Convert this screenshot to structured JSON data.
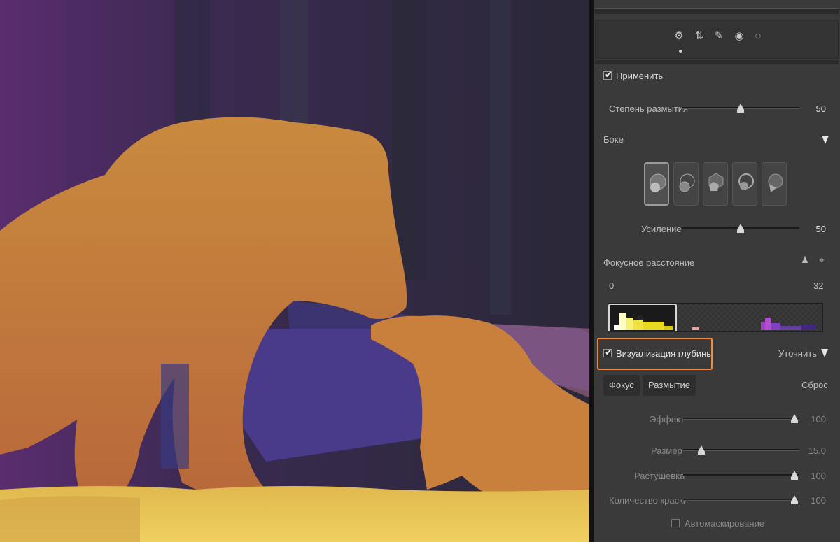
{
  "toolbar": {
    "tools": [
      {
        "icon": "sliders-icon",
        "glyph": "⚙"
      },
      {
        "icon": "crop-rotate-icon",
        "glyph": "⇅"
      },
      {
        "icon": "brush-icon",
        "glyph": "✎"
      },
      {
        "icon": "red-eye-icon",
        "glyph": "◉"
      },
      {
        "icon": "vignette-icon",
        "glyph": "◌"
      }
    ]
  },
  "apply": {
    "label": "Применить",
    "checked": true
  },
  "blur_amount": {
    "label": "Степень размытия",
    "value": "50",
    "level": 0.5
  },
  "bokeh": {
    "label": "Боке"
  },
  "boost": {
    "label": "Усиление",
    "value": "50",
    "level": 0.5
  },
  "focal": {
    "label": "Фокусное расстояние",
    "min": "0",
    "max": "32"
  },
  "depth_vis": {
    "label": "Визуализация глубины",
    "checked": true
  },
  "refine": {
    "label": "Уточнить"
  },
  "tabs": {
    "focus": "Фокус",
    "blur": "Размытие",
    "reset": "Сброс"
  },
  "effect": {
    "label": "Эффект",
    "value": "100",
    "level": 1.0
  },
  "size": {
    "label": "Размер",
    "value": "15.0",
    "level": 0.15
  },
  "feather": {
    "label": "Растушевка",
    "value": "100",
    "level": 1.0
  },
  "flow": {
    "label": "Количество краски",
    "value": "100",
    "level": 1.0
  },
  "automask": {
    "label": "Автомаскирование",
    "checked": false
  },
  "colors": {
    "accent_highlight": "#f08a3c",
    "bear_overlay": "#c9853a",
    "snow_overlay": "#e6c24a"
  }
}
